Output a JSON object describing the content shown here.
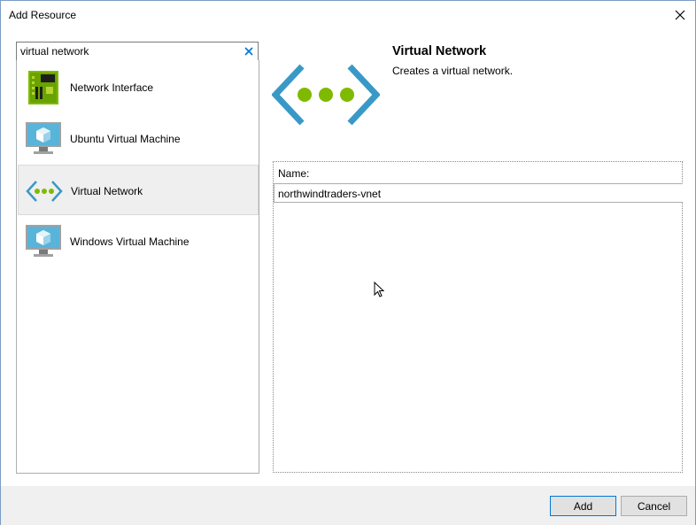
{
  "window": {
    "title": "Add Resource"
  },
  "search": {
    "value": "virtual network"
  },
  "resources": [
    {
      "label": "Network Interface",
      "icon": "network-interface-icon"
    },
    {
      "label": "Ubuntu Virtual Machine",
      "icon": "virtual-machine-icon"
    },
    {
      "label": "Virtual Network",
      "icon": "virtual-network-icon",
      "selected": true
    },
    {
      "label": "Windows Virtual Machine",
      "icon": "virtual-machine-icon"
    }
  ],
  "detail": {
    "title": "Virtual Network",
    "description": "Creates a virtual network.",
    "name_label": "Name:",
    "name_value": "northwindtraders-vnet"
  },
  "buttons": {
    "add": "Add",
    "cancel": "Cancel"
  },
  "colors": {
    "accent": "#0078d7",
    "vnet_dots": "#7fba00",
    "vnet_brackets": "#3999c6",
    "nic_green": "#7fba00",
    "vm_blue": "#59b4d9"
  }
}
